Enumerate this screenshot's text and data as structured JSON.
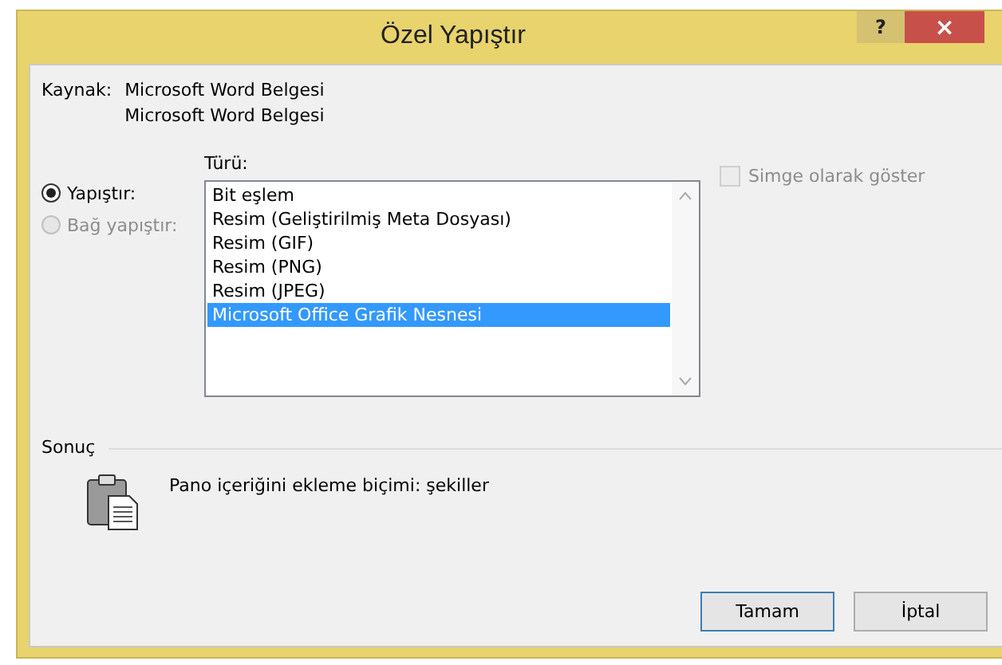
{
  "window": {
    "title": "Özel Yapıştır",
    "help_button": "?",
    "close_button": "×"
  },
  "source": {
    "label": "Kaynak:",
    "lines": [
      "Microsoft Word Belgesi",
      "Microsoft Word Belgesi"
    ]
  },
  "paste_options": [
    {
      "label": "Yapıştır:",
      "selected": true,
      "disabled": false
    },
    {
      "label": "Bağ yapıştır:",
      "selected": false,
      "disabled": true
    }
  ],
  "type_list": {
    "label": "Türü:",
    "items": [
      {
        "label": "Bit eşlem",
        "selected": false
      },
      {
        "label": "Resim (Geliştirilmiş Meta Dosyası)",
        "selected": false
      },
      {
        "label": "Resim (GIF)",
        "selected": false
      },
      {
        "label": "Resim (PNG)",
        "selected": false
      },
      {
        "label": "Resim (JPEG)",
        "selected": false
      },
      {
        "label": "Microsoft Office Grafik Nesnesi",
        "selected": true
      }
    ]
  },
  "display_as_icon": {
    "label": "Simge olarak göster",
    "checked": false,
    "disabled": true
  },
  "result": {
    "label": "Sonuç",
    "text": "Pano içeriğini ekleme biçimi: şekiller"
  },
  "buttons": [
    "Tamam",
    "İptal"
  ]
}
